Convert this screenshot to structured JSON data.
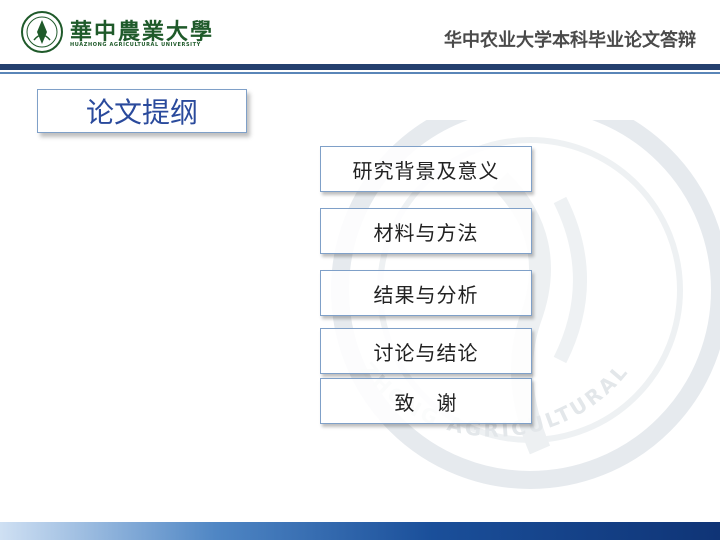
{
  "header": {
    "logo_cn": "華中農業大學",
    "logo_en": "HUAZHONG AGRICULTURAL UNIVERSITY",
    "title": "华中农业大学本科毕业论文答辩"
  },
  "section": {
    "title": "论文提纲"
  },
  "menu": [
    {
      "label": "研究背景及意义"
    },
    {
      "label": "材料与方法"
    },
    {
      "label": "结果与分析"
    },
    {
      "label": "讨论与结论"
    },
    {
      "label": "致　谢"
    }
  ],
  "watermark": {
    "text": "ZHONG AGRICULTURAL UNIVERSITY"
  },
  "colors": {
    "navy": "#24406e",
    "accent_blue": "#2a4a9c",
    "green": "#1f5a2a"
  }
}
